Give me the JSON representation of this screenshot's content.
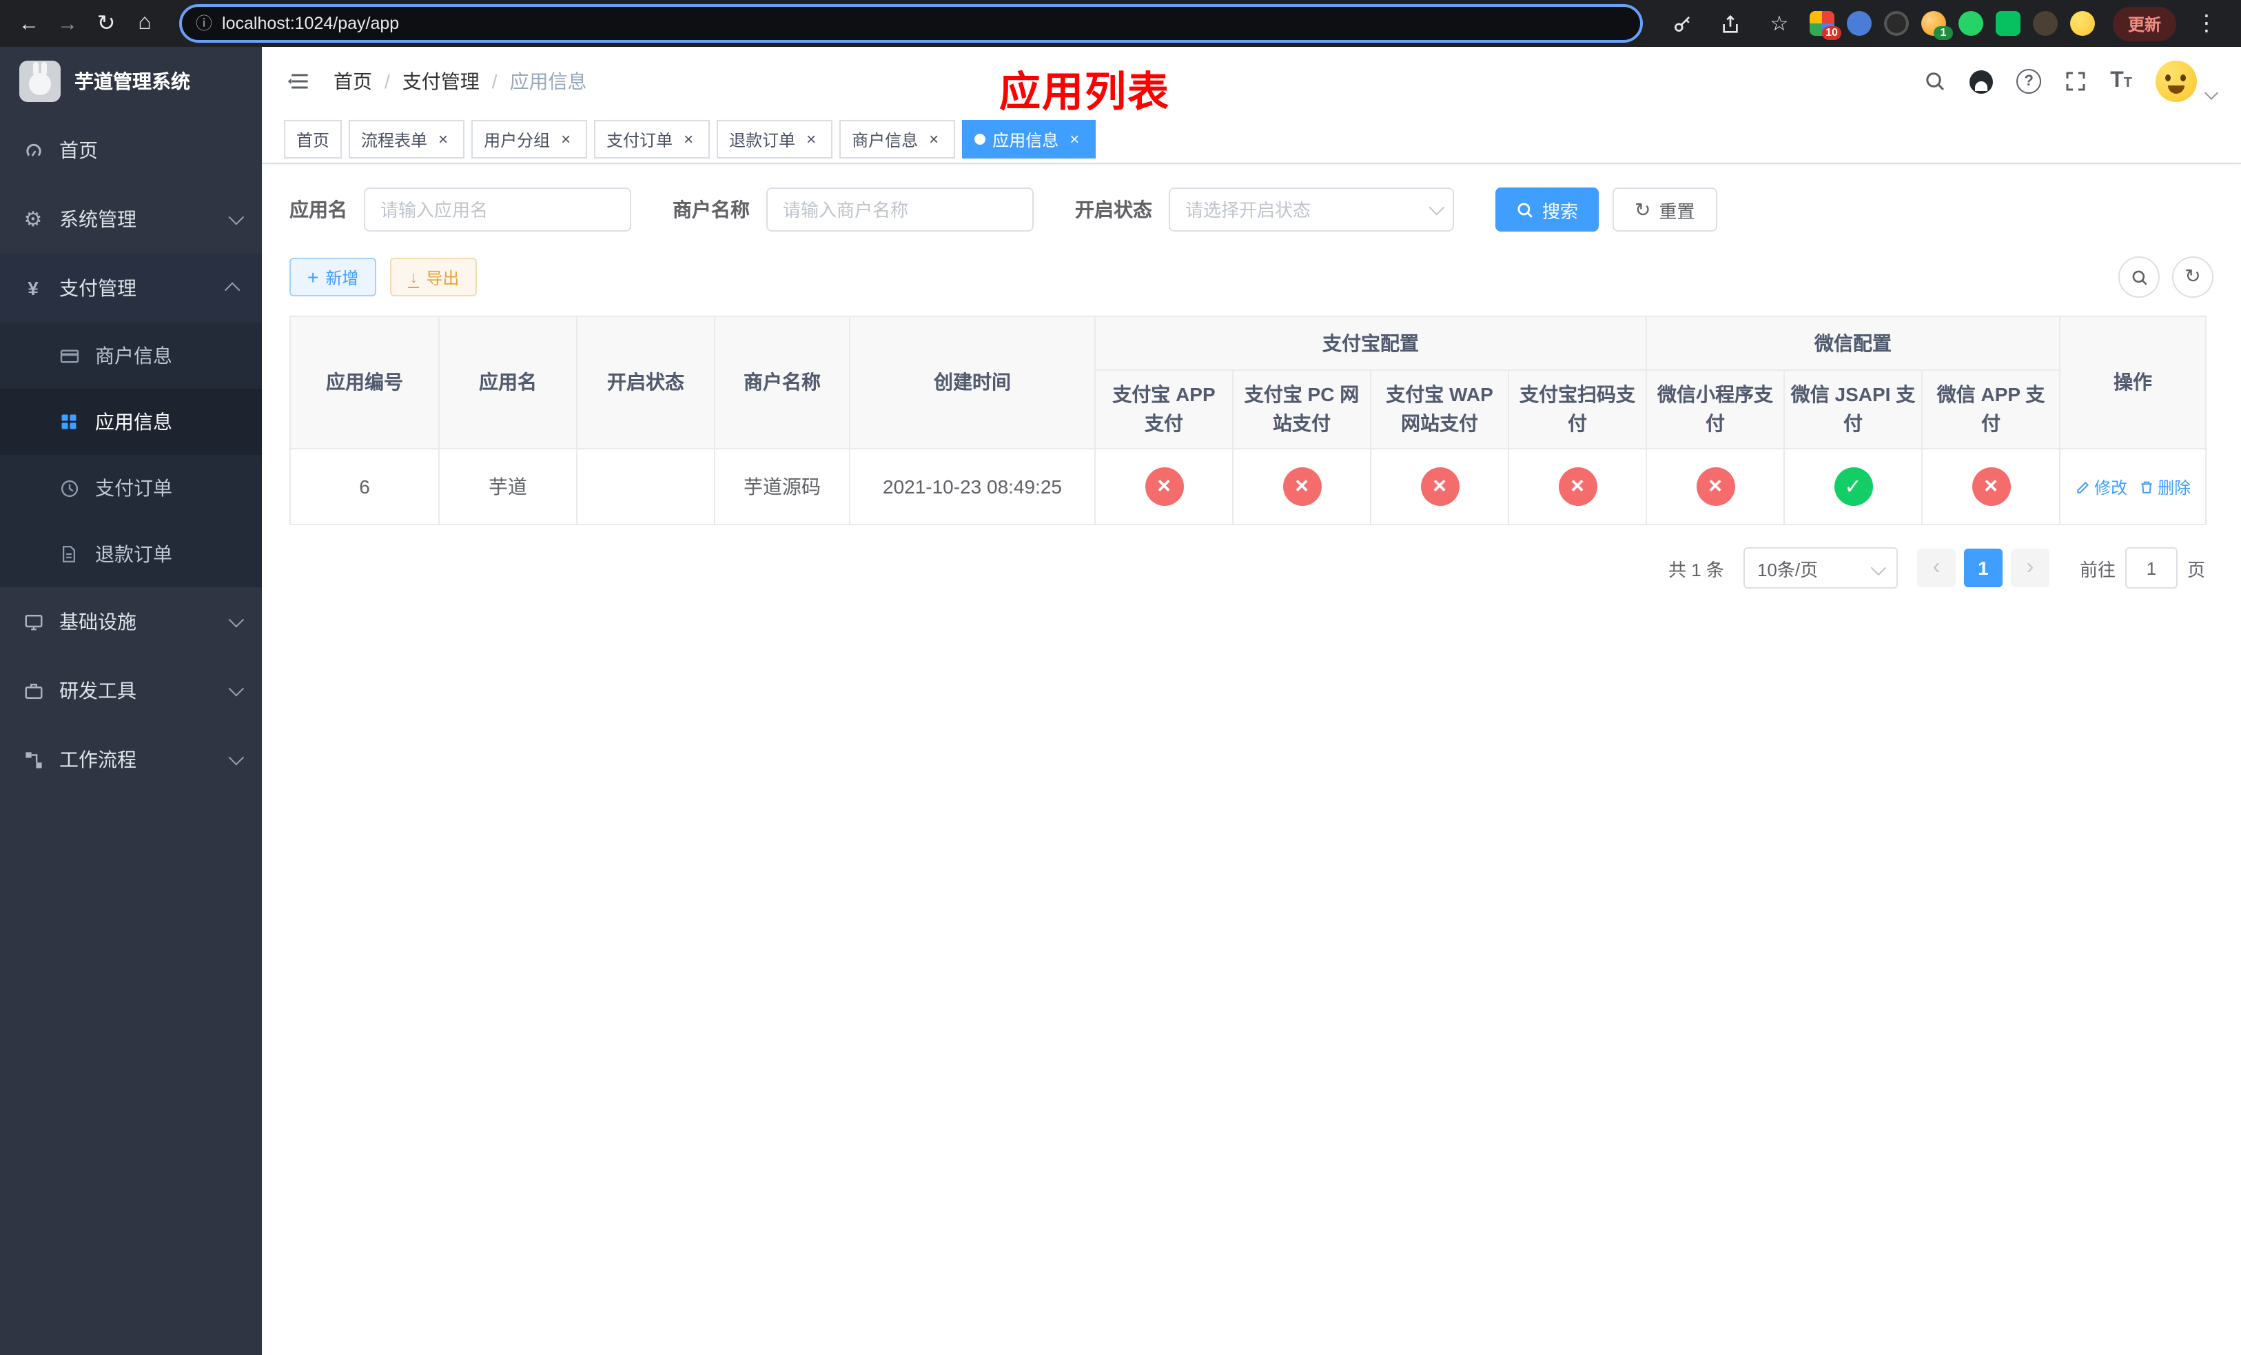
{
  "browser": {
    "url": "localhost:1024/pay/app",
    "update_label": "更新",
    "extension_badge_count": "10",
    "profile_badge_count": "1"
  },
  "sidebar": {
    "app_title": "芋道管理系统",
    "home": "首页",
    "system_mgmt": "系统管理",
    "payment_mgmt": "支付管理",
    "merchant_info": "商户信息",
    "app_info": "应用信息",
    "payment_order": "支付订单",
    "refund_order": "退款订单",
    "infrastructure": "基础设施",
    "dev_tools": "研发工具",
    "workflow": "工作流程"
  },
  "header": {
    "breadcrumb_home": "首页",
    "breadcrumb_section": "支付管理",
    "breadcrumb_current": "应用信息",
    "overlay_title": "应用列表"
  },
  "tabs": [
    {
      "label": "首页",
      "closable": false,
      "active": false
    },
    {
      "label": "流程表单",
      "closable": true,
      "active": false
    },
    {
      "label": "用户分组",
      "closable": true,
      "active": false
    },
    {
      "label": "支付订单",
      "closable": true,
      "active": false
    },
    {
      "label": "退款订单",
      "closable": true,
      "active": false
    },
    {
      "label": "商户信息",
      "closable": true,
      "active": false
    },
    {
      "label": "应用信息",
      "closable": true,
      "active": true
    }
  ],
  "filters": {
    "app_name_label": "应用名",
    "app_name_placeholder": "请输入应用名",
    "merchant_name_label": "商户名称",
    "merchant_name_placeholder": "请输入商户名称",
    "status_label": "开启状态",
    "status_placeholder": "请选择开启状态",
    "search_label": "搜索",
    "reset_label": "重置"
  },
  "toolbar": {
    "add_label": "新增",
    "export_label": "导出"
  },
  "table": {
    "group_alipay": "支付宝配置",
    "group_wechat": "微信配置",
    "columns": [
      "应用编号",
      "应用名",
      "开启状态",
      "商户名称",
      "创建时间",
      "支付宝 APP 支付",
      "支付宝 PC 网站支付",
      "支付宝 WAP 网站支付",
      "支付宝扫码支付",
      "微信小程序支付",
      "微信 JSAPI 支付",
      "微信 APP 支付",
      "操作"
    ],
    "rows": [
      {
        "app_id": "6",
        "app_name": "芋道",
        "status_enabled": true,
        "merchant_name": "芋道源码",
        "created_at": "2021-10-23 08:49:25",
        "alipay_app": false,
        "alipay_pc": false,
        "alipay_wap": false,
        "alipay_qr": false,
        "wechat_mini": false,
        "wechat_jsapi": true,
        "wechat_app": false,
        "edit_label": "修改",
        "delete_label": "删除"
      }
    ]
  },
  "pagination": {
    "total_label": "共 1 条",
    "page_size_label": "10条/页",
    "current_page": "1",
    "goto_label": "前往",
    "goto_value": "1",
    "page_unit_label": "页"
  },
  "colors": {
    "primary": "#409EFF",
    "danger": "#f56c6c",
    "success": "#13ce66"
  }
}
